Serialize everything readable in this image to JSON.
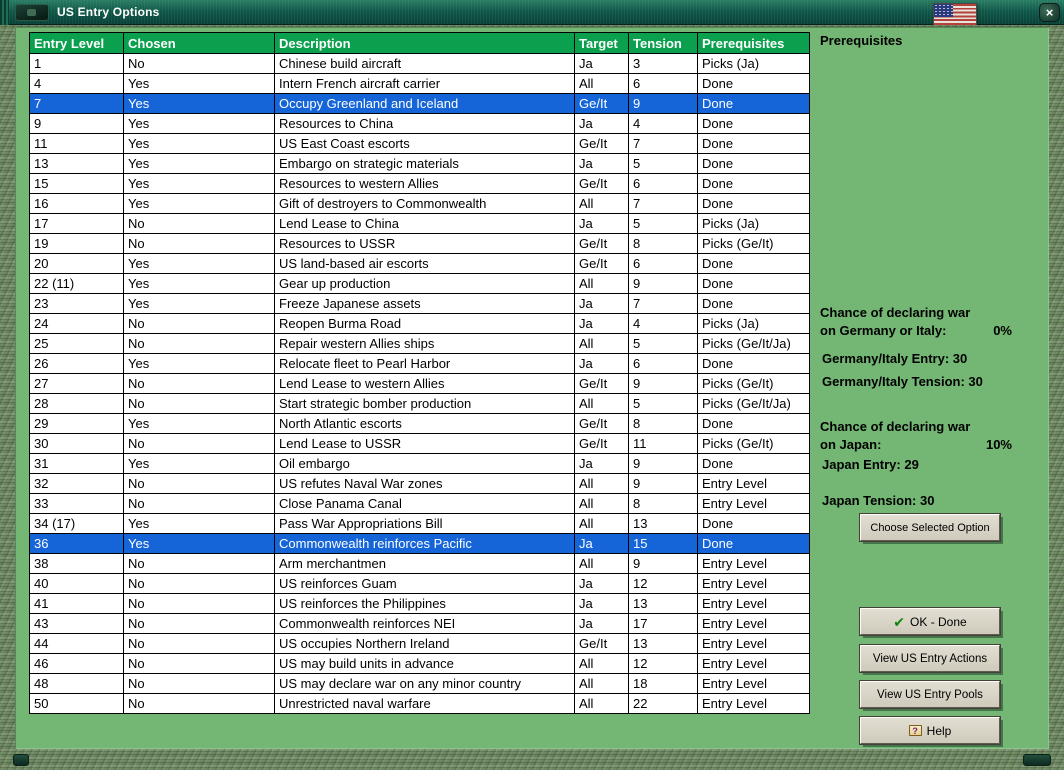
{
  "window": {
    "title": "US Entry Options"
  },
  "colors": {
    "header_green": "#0aa04d",
    "selection_blue": "#1565d8",
    "background_green": "#74b674",
    "titlebar_green": "#10594a"
  },
  "icons": {
    "close_glyph": "×",
    "check_glyph": "✔",
    "help_glyph": "?"
  },
  "table": {
    "headers": [
      "Entry Level",
      "Chosen",
      "Description",
      "Target",
      "Tension",
      "Prerequisites"
    ],
    "rows": [
      {
        "cells": [
          "1",
          "No",
          "Chinese build aircraft",
          "Ja",
          "3",
          "Picks (Ja)"
        ],
        "selected": false
      },
      {
        "cells": [
          "4",
          "Yes",
          "Intern French aircraft carrier",
          "All",
          "6",
          "Done"
        ],
        "selected": false
      },
      {
        "cells": [
          "7",
          "Yes",
          "Occupy Greenland and Iceland",
          "Ge/It",
          "9",
          "Done"
        ],
        "selected": true
      },
      {
        "cells": [
          "9",
          "Yes",
          "Resources to China",
          "Ja",
          "4",
          "Done"
        ],
        "selected": false
      },
      {
        "cells": [
          "11",
          "Yes",
          "US East Coast escorts",
          "Ge/It",
          "7",
          "Done"
        ],
        "selected": false
      },
      {
        "cells": [
          "13",
          "Yes",
          "Embargo on strategic materials",
          "Ja",
          "5",
          "Done"
        ],
        "selected": false
      },
      {
        "cells": [
          "15",
          "Yes",
          "Resources to western Allies",
          "Ge/It",
          "6",
          "Done"
        ],
        "selected": false
      },
      {
        "cells": [
          "16",
          "Yes",
          "Gift of destroyers to Commonwealth",
          "All",
          "7",
          "Done"
        ],
        "selected": false
      },
      {
        "cells": [
          "17",
          "No",
          "Lend Lease to China",
          "Ja",
          "5",
          "Picks (Ja)"
        ],
        "selected": false
      },
      {
        "cells": [
          "19",
          "No",
          "Resources to USSR",
          "Ge/It",
          "8",
          "Picks (Ge/It)"
        ],
        "selected": false
      },
      {
        "cells": [
          "20",
          "Yes",
          "US land-based air escorts",
          "Ge/It",
          "6",
          "Done"
        ],
        "selected": false
      },
      {
        "cells": [
          "22 (11)",
          "Yes",
          "Gear up production",
          "All",
          "9",
          "Done"
        ],
        "selected": false
      },
      {
        "cells": [
          "23",
          "Yes",
          "Freeze Japanese assets",
          "Ja",
          "7",
          "Done"
        ],
        "selected": false
      },
      {
        "cells": [
          "24",
          "No",
          "Reopen Burma Road",
          "Ja",
          "4",
          "Picks (Ja)"
        ],
        "selected": false
      },
      {
        "cells": [
          "25",
          "No",
          "Repair western Allies ships",
          "All",
          "5",
          "Picks (Ge/It/Ja)"
        ],
        "selected": false
      },
      {
        "cells": [
          "26",
          "Yes",
          "Relocate fleet to Pearl Harbor",
          "Ja",
          "6",
          "Done"
        ],
        "selected": false
      },
      {
        "cells": [
          "27",
          "No",
          "Lend Lease to western Allies",
          "Ge/It",
          "9",
          "Picks (Ge/It)"
        ],
        "selected": false
      },
      {
        "cells": [
          "28",
          "No",
          "Start strategic bomber production",
          "All",
          "5",
          "Picks (Ge/It/Ja)"
        ],
        "selected": false
      },
      {
        "cells": [
          "29",
          "Yes",
          "North Atlantic escorts",
          "Ge/It",
          "8",
          "Done"
        ],
        "selected": false
      },
      {
        "cells": [
          "30",
          "No",
          "Lend Lease to USSR",
          "Ge/It",
          "11",
          "Picks (Ge/It)"
        ],
        "selected": false
      },
      {
        "cells": [
          "31",
          "Yes",
          "Oil embargo",
          "Ja",
          "9",
          "Done"
        ],
        "selected": false
      },
      {
        "cells": [
          "32",
          "No",
          "US refutes Naval War zones",
          "All",
          "9",
          "Entry Level"
        ],
        "selected": false
      },
      {
        "cells": [
          "33",
          "No",
          "Close Panama Canal",
          "All",
          "8",
          "Entry Level"
        ],
        "selected": false
      },
      {
        "cells": [
          "34 (17)",
          "Yes",
          "Pass War Appropriations Bill",
          "All",
          "13",
          "Done"
        ],
        "selected": false
      },
      {
        "cells": [
          "36",
          "Yes",
          "Commonwealth reinforces Pacific",
          "Ja",
          "15",
          "Done"
        ],
        "selected": true
      },
      {
        "cells": [
          "38",
          "No",
          "Arm merchantmen",
          "All",
          "9",
          "Entry Level"
        ],
        "selected": false
      },
      {
        "cells": [
          "40",
          "No",
          "US reinforces Guam",
          "Ja",
          "12",
          "Entry Level"
        ],
        "selected": false
      },
      {
        "cells": [
          "41",
          "No",
          "US reinforces the Philippines",
          "Ja",
          "13",
          "Entry Level"
        ],
        "selected": false
      },
      {
        "cells": [
          "43",
          "No",
          "Commonwealth reinforces NEI",
          "Ja",
          "17",
          "Entry Level"
        ],
        "selected": false
      },
      {
        "cells": [
          "44",
          "No",
          "US occupies Northern Ireland",
          "Ge/It",
          "13",
          "Entry Level"
        ],
        "selected": false
      },
      {
        "cells": [
          "46",
          "No",
          "US may build units in advance",
          "All",
          "12",
          "Entry Level"
        ],
        "selected": false
      },
      {
        "cells": [
          "48",
          "No",
          "US may declare war on any minor country",
          "All",
          "18",
          "Entry Level"
        ],
        "selected": false
      },
      {
        "cells": [
          "50",
          "No",
          "Unrestricted naval warfare",
          "All",
          "22",
          "Entry Level"
        ],
        "selected": false
      }
    ]
  },
  "panel": {
    "title": "Prerequisites",
    "germany": {
      "line1": "Chance of declaring war",
      "line2": "on Germany or Italy:",
      "chance": "0%",
      "entry": "Germany/Italy Entry: 30",
      "tension": "Germany/Italy Tension: 30"
    },
    "japan": {
      "line1": "Chance of declaring war",
      "line2": "on Japan:",
      "chance": "10%",
      "entry": "Japan Entry: 29",
      "tension": "Japan Tension: 30"
    },
    "choose_button": "Choose Selected Option",
    "ok_button": "OK - Done",
    "view_actions_button": "View US Entry Actions",
    "view_pools_button": "View US Entry Pools",
    "help_button": "Help"
  }
}
